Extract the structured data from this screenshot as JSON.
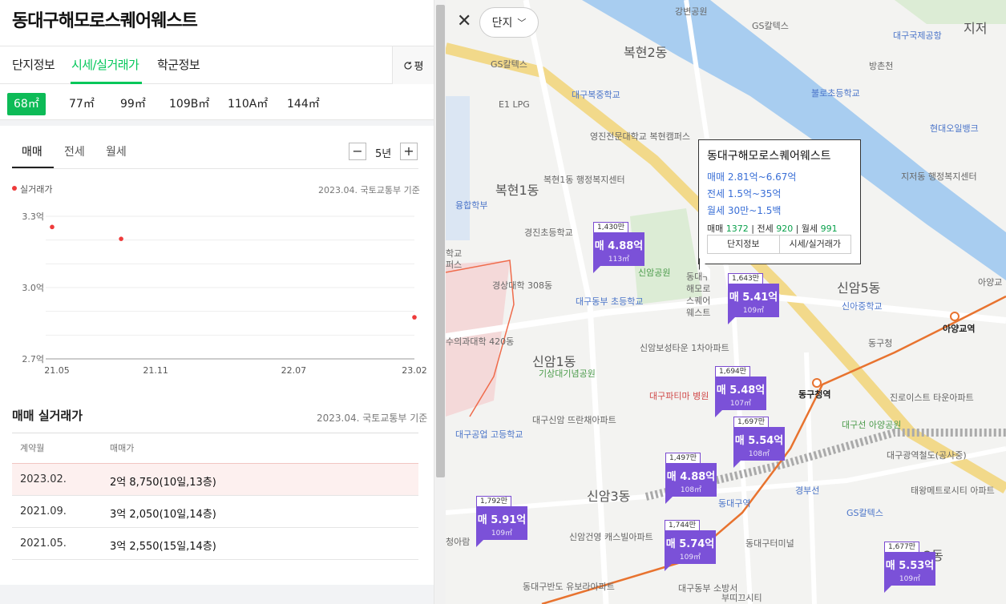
{
  "panel": {
    "title": "동대구해모로스퀘어웨스트",
    "tabs": [
      "단지정보",
      "시세/실거래가",
      "학군정보"
    ],
    "pyeong_label": "평",
    "areas": [
      "68㎡",
      "77㎡",
      "99㎡",
      "109B㎡",
      "110A㎡",
      "144㎡"
    ],
    "sub_tabs": [
      "매매",
      "전세",
      "월세"
    ],
    "period": "5년",
    "zoom_out": "−",
    "zoom_in": "+",
    "legend": "실거래가",
    "basis": "2023.04. 국토교통부 기준",
    "section_title": "매매 실거래가",
    "table": {
      "headers": [
        "계약월",
        "매매가"
      ],
      "rows": [
        {
          "month": "2023.02.",
          "price": "2억 8,750(10일,13층)"
        },
        {
          "month": "2021.09.",
          "price": "3억 2,050(10일,14층)"
        },
        {
          "month": "2021.05.",
          "price": "3억 2,550(15일,14층)"
        }
      ]
    }
  },
  "chart_data": {
    "type": "scatter",
    "y_ticks": [
      "3.3억",
      "3.0억",
      "2.7억"
    ],
    "x_ticks": [
      "21.05",
      "21.11",
      "22.07",
      "23.02"
    ],
    "ylim": [
      2.7,
      3.3
    ],
    "points": [
      {
        "x": "2021-05",
        "y": 3.255
      },
      {
        "x": "2021-09",
        "y": 3.205
      },
      {
        "x": "2023-02",
        "y": 2.875
      }
    ],
    "color": "#ee3b3b"
  },
  "map": {
    "danji_label": "단지",
    "popup": {
      "name": "동대구해모로스퀘어웨스트",
      "sale": "매매 2.81억~6.67억",
      "jeonse": "전세 1.5억~35억",
      "wolse": "월세 30만~1.5백",
      "counts": [
        {
          "label": "매매",
          "value": "1372"
        },
        {
          "label": "전세",
          "value": "920"
        },
        {
          "label": "월세",
          "value": "991"
        }
      ],
      "btn_info": "단지정보",
      "btn_price": "시세/실거래가"
    },
    "markers": [
      {
        "count": "1,430만",
        "price": "매 4.88억",
        "size": "113㎡"
      },
      {
        "count": "1,643만",
        "price": "매 5.41억",
        "size": "109㎡"
      },
      {
        "count": "1,694만",
        "price": "매 5.48억",
        "size": "107㎡"
      },
      {
        "count": "1,697만",
        "price": "매 5.54억",
        "size": "108㎡"
      },
      {
        "count": "1,497만",
        "price": "매 4.88억",
        "size": "108㎡"
      },
      {
        "count": "1,792만",
        "price": "매 5.91억",
        "size": "109㎡"
      },
      {
        "count": "1,744만",
        "price": "매 5.74억",
        "size": "109㎡"
      },
      {
        "count": "1,677만",
        "price": "매 5.53억",
        "size": "109㎡"
      }
    ],
    "labels": [
      "복현2동",
      "강변공원",
      "GS칼텍스",
      "대구국제공항",
      "방촌천",
      "GS칼텍스",
      "E1 LPG",
      "대구복중학교",
      "불로초등학교",
      "영진전문대학교 복현캠퍼스",
      "복현1동 행정복지센터",
      "복현1동",
      "지저동 행정복지센터",
      "현대오일뱅크",
      "융합학부",
      "경진초등학교",
      "학교",
      "퍼스",
      "신암공원",
      "경상대학 308동",
      "대구동부 초등학교",
      "신암5동",
      "신아중학교",
      "아양교역",
      "동구청",
      "수의과대학 420동",
      "신암보성타운 1차아파트",
      "신암1동",
      "기상대기념공원",
      "대구파티마 병원",
      "동구청역",
      "진로이스트 타운아파트",
      "대구신암 뜨란채아파트",
      "대구선 아양공원",
      "대구공업 고등학교",
      "신암3동",
      "동대구역",
      "GS칼텍스",
      "태왕메트로시티 아파트",
      "신암건영 캐스빌아파트",
      "동대구터미널",
      "동대구반도 유보라아파트",
      "대구동부 소방서",
      "부띠끄시티",
      "2동",
      "지저",
      "아양교",
      "동대구 해모로 스퀘어 웨스트",
      "청아람",
      "대구광역철도(공사중)",
      "경부선"
    ]
  }
}
